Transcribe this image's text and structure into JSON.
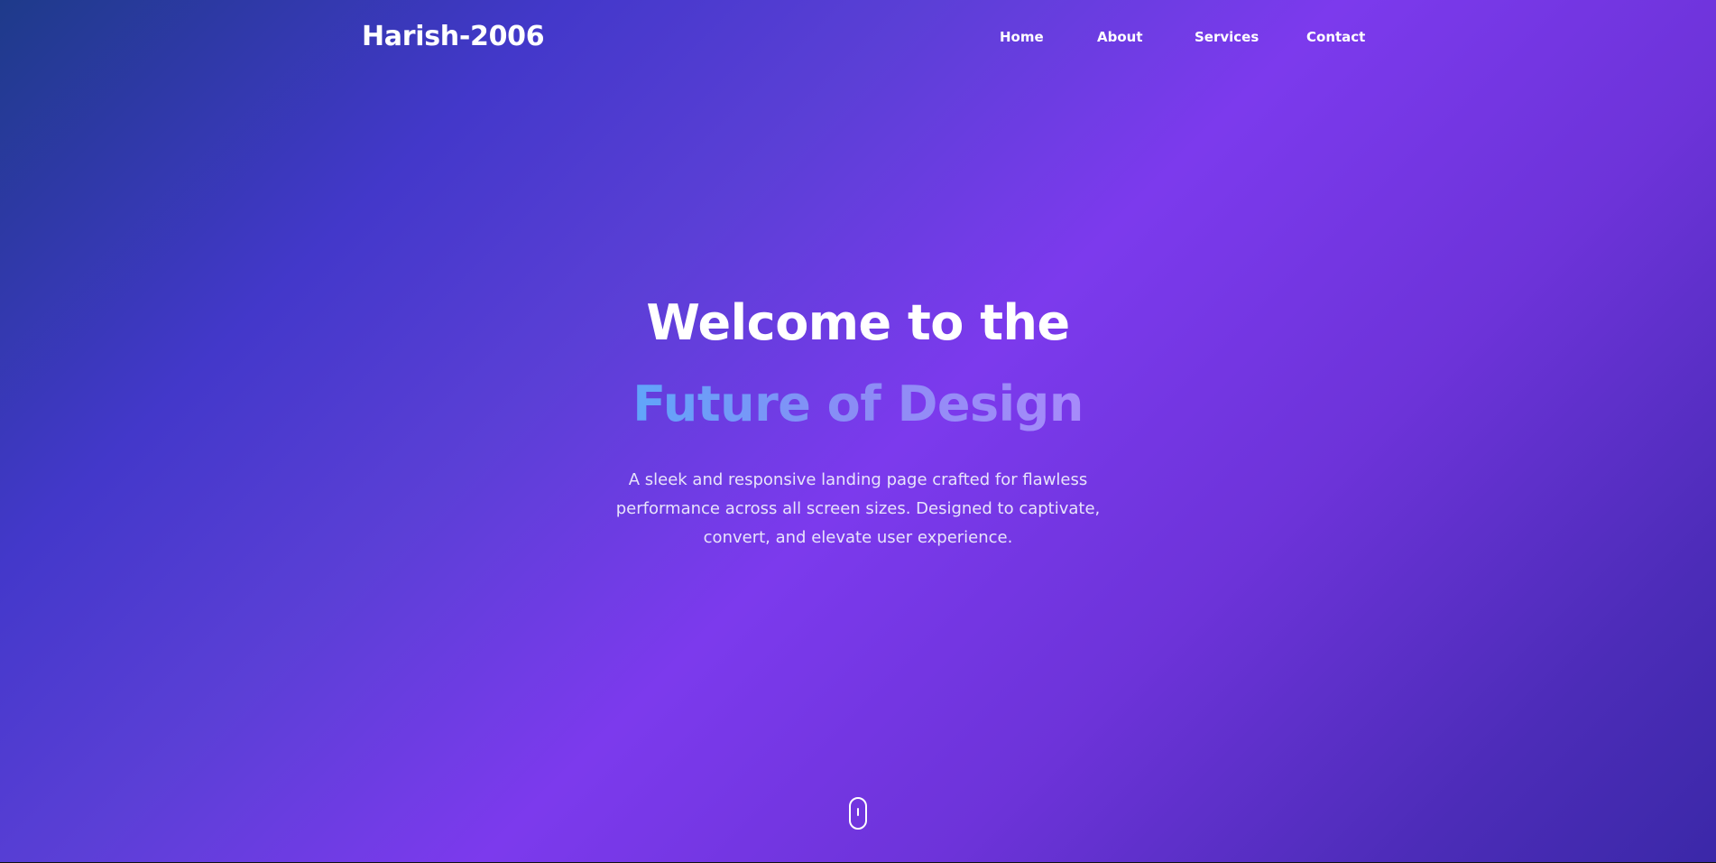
{
  "header": {
    "brand": "Harish-2006",
    "nav": {
      "home": "Home",
      "about": "About",
      "services": "Services",
      "contact": "Contact"
    }
  },
  "hero": {
    "title_line1": "Welcome to the",
    "title_line2": "Future of Design",
    "description": "A sleek and responsive landing page crafted for flawless performance across all screen sizes. Designed to captivate, convert, and elevate user experience."
  },
  "icons": {
    "scroll": "mouse-scroll-icon"
  },
  "colors": {
    "gradient_start": "#1e3a8a",
    "gradient_mid": "#7c3aed",
    "gradient_end": "#3b28a8",
    "accent_text_start": "#60a5fa",
    "accent_text_end": "#a78bfa",
    "text": "#ffffff"
  }
}
